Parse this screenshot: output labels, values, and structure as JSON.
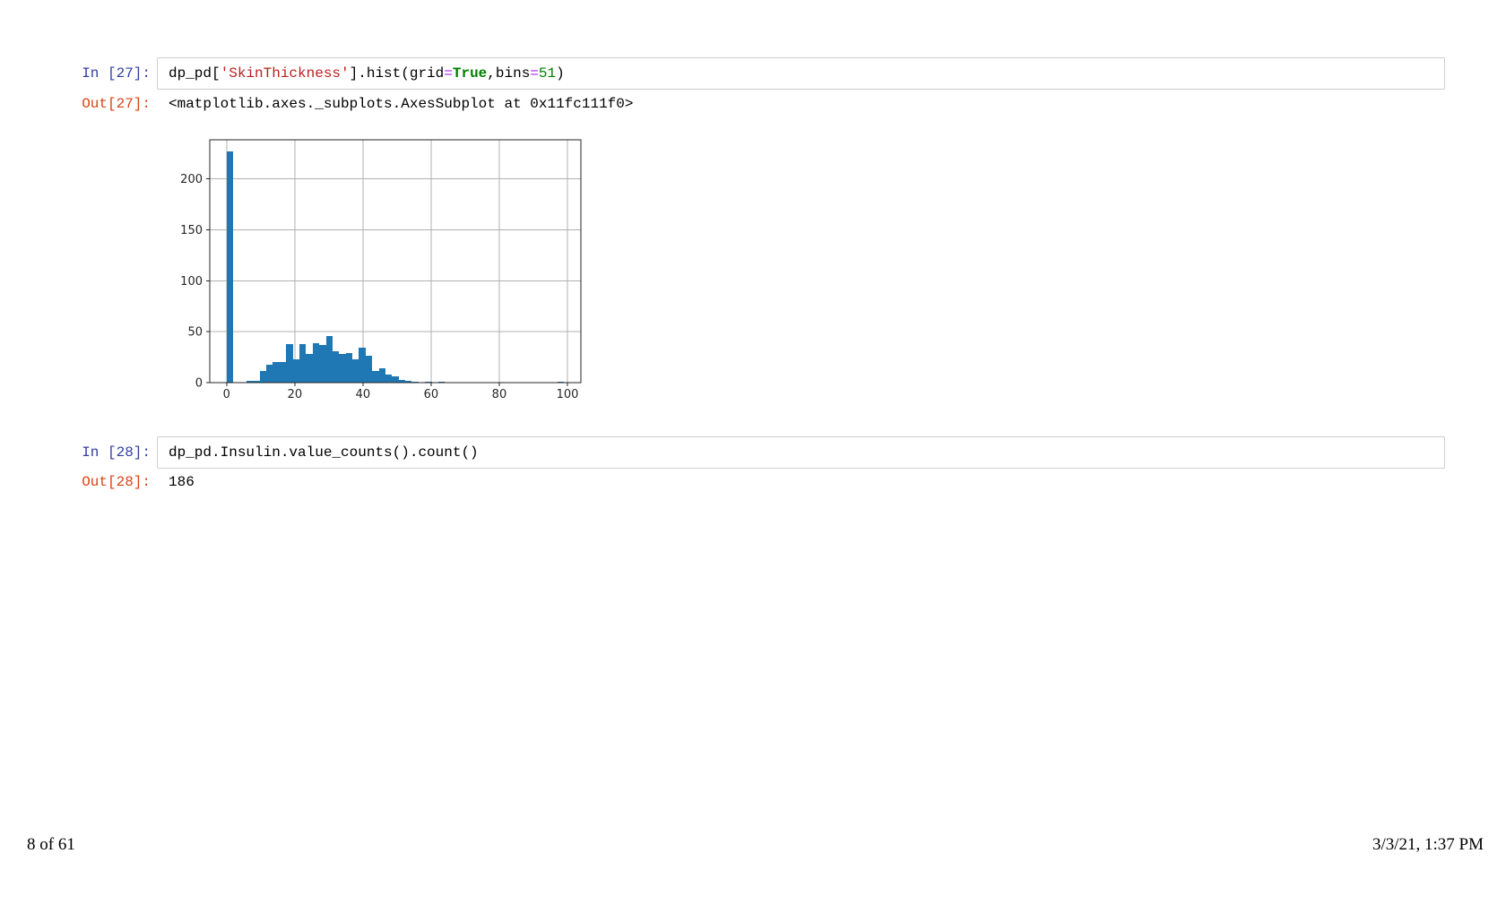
{
  "notebook": {
    "cells": [
      {
        "in_prompt": "In [27]:",
        "code_tokens": [
          {
            "text": "dp_pd[",
            "style": "plain"
          },
          {
            "text": "'SkinThickness'",
            "style": "string"
          },
          {
            "text": "].hist(grid",
            "style": "plain"
          },
          {
            "text": "=",
            "style": "operator"
          },
          {
            "text": "True",
            "style": "keyword"
          },
          {
            "text": ",bins",
            "style": "plain"
          },
          {
            "text": "=",
            "style": "operator"
          },
          {
            "text": "51",
            "style": "number"
          },
          {
            "text": ")",
            "style": "plain"
          }
        ],
        "out_prompt": "Out[27]:",
        "output": "<matplotlib.axes._subplots.AxesSubplot at 0x11fc111f0>"
      },
      {
        "in_prompt": "In [28]:",
        "code_tokens": [
          {
            "text": "dp_pd.Insulin.value_counts().count()",
            "style": "plain"
          }
        ],
        "out_prompt": "Out[28]:",
        "output": "186"
      }
    ]
  },
  "footer": {
    "left": "8 of 61",
    "right": "3/3/21, 1:37 PM"
  },
  "colors": {
    "in_prompt": "#303F9F",
    "out_prompt": "#D84315",
    "code_string": "#BA2121",
    "code_operator": "#AA22FF",
    "code_keyword": "#008000",
    "code_number": "#008000",
    "bar": "#1f77b4",
    "grid": "#b0b0b0",
    "axis": "#262626"
  },
  "chart_data": {
    "type": "bar",
    "subtype": "histogram",
    "series_name": "SkinThickness",
    "title": "",
    "xlabel": "",
    "ylabel": "",
    "bin_start": 0,
    "bin_width": 1.9411764705882353,
    "values": [
      227,
      0,
      0,
      2,
      2,
      11,
      18,
      20,
      20,
      38,
      23,
      38,
      28,
      39,
      37,
      46,
      31,
      28,
      29,
      23,
      34,
      26,
      11,
      14,
      8,
      6,
      3,
      2,
      1,
      0,
      1,
      0,
      1,
      0,
      0,
      0,
      0,
      0,
      0,
      0,
      0,
      0,
      0,
      0,
      0,
      0,
      0,
      0,
      0,
      0,
      1
    ],
    "x_ticks": [
      0,
      20,
      40,
      60,
      80,
      100
    ],
    "y_ticks": [
      0,
      50,
      100,
      150,
      200
    ],
    "xlim": [
      -4.95,
      103.95
    ],
    "ylim": [
      0,
      238.35
    ],
    "grid": true,
    "legend": false,
    "bar_color": "#1f77b4",
    "grid_color": "#b0b0b0"
  }
}
